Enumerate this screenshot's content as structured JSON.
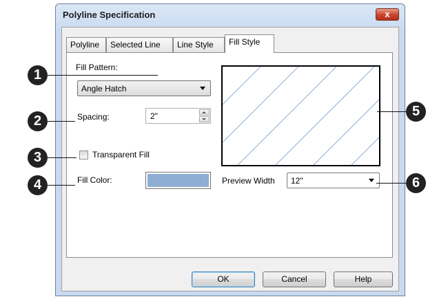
{
  "window": {
    "title": "Polyline Specification",
    "close_glyph": "x"
  },
  "tabs": [
    {
      "label": "Polyline",
      "active": false
    },
    {
      "label": "Selected Line",
      "active": false
    },
    {
      "label": "Line Style",
      "active": false
    },
    {
      "label": "Fill Style",
      "active": true
    }
  ],
  "fill_pattern": {
    "label": "Fill Pattern:",
    "value": "Angle Hatch"
  },
  "spacing": {
    "label": "Spacing:",
    "value": "2\""
  },
  "transparent_fill": {
    "label": "Transparent Fill",
    "checked": false
  },
  "fill_color": {
    "label": "Fill Color:",
    "color": "#8eaed3"
  },
  "preview": {
    "pattern": "angle-hatch",
    "line_color": "#8eaed3"
  },
  "preview_width": {
    "label": "Preview Width",
    "value": "12\""
  },
  "buttons": {
    "ok": "OK",
    "cancel": "Cancel",
    "help": "Help"
  },
  "callouts": [
    "1",
    "2",
    "3",
    "4",
    "5",
    "6"
  ]
}
